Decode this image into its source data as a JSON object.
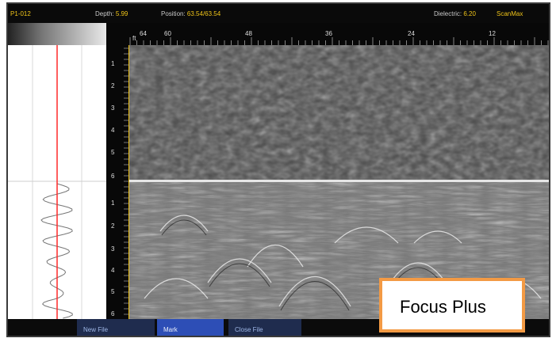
{
  "status": {
    "file_id": "P1-012",
    "depth_label": "Depth:",
    "depth_value": "5.99",
    "position_label": "Position:",
    "position_value": "63.54/63.54",
    "dielectric_label": "Dielectric:",
    "dielectric_value": "6.20",
    "brand": "ScanMax"
  },
  "ruler": {
    "unit": "ft",
    "labels": [
      "64",
      "60",
      "48",
      "36",
      "24",
      "12"
    ]
  },
  "depth_axis": {
    "upper_labels": [
      "1",
      "2",
      "3",
      "4",
      "5",
      "6"
    ],
    "lower_labels": [
      "1",
      "2",
      "3",
      "4",
      "5",
      "6"
    ]
  },
  "toolbar": {
    "new_file": "New File",
    "mark": "Mark",
    "close_file": "Close File"
  },
  "callout": {
    "label": "Focus Plus"
  },
  "colors": {
    "accent_yellow": "#f0c419",
    "toolbar_blue": "#2d4eb6",
    "callout_orange": "#f39a44",
    "trace_red": "#ff2a2a"
  }
}
